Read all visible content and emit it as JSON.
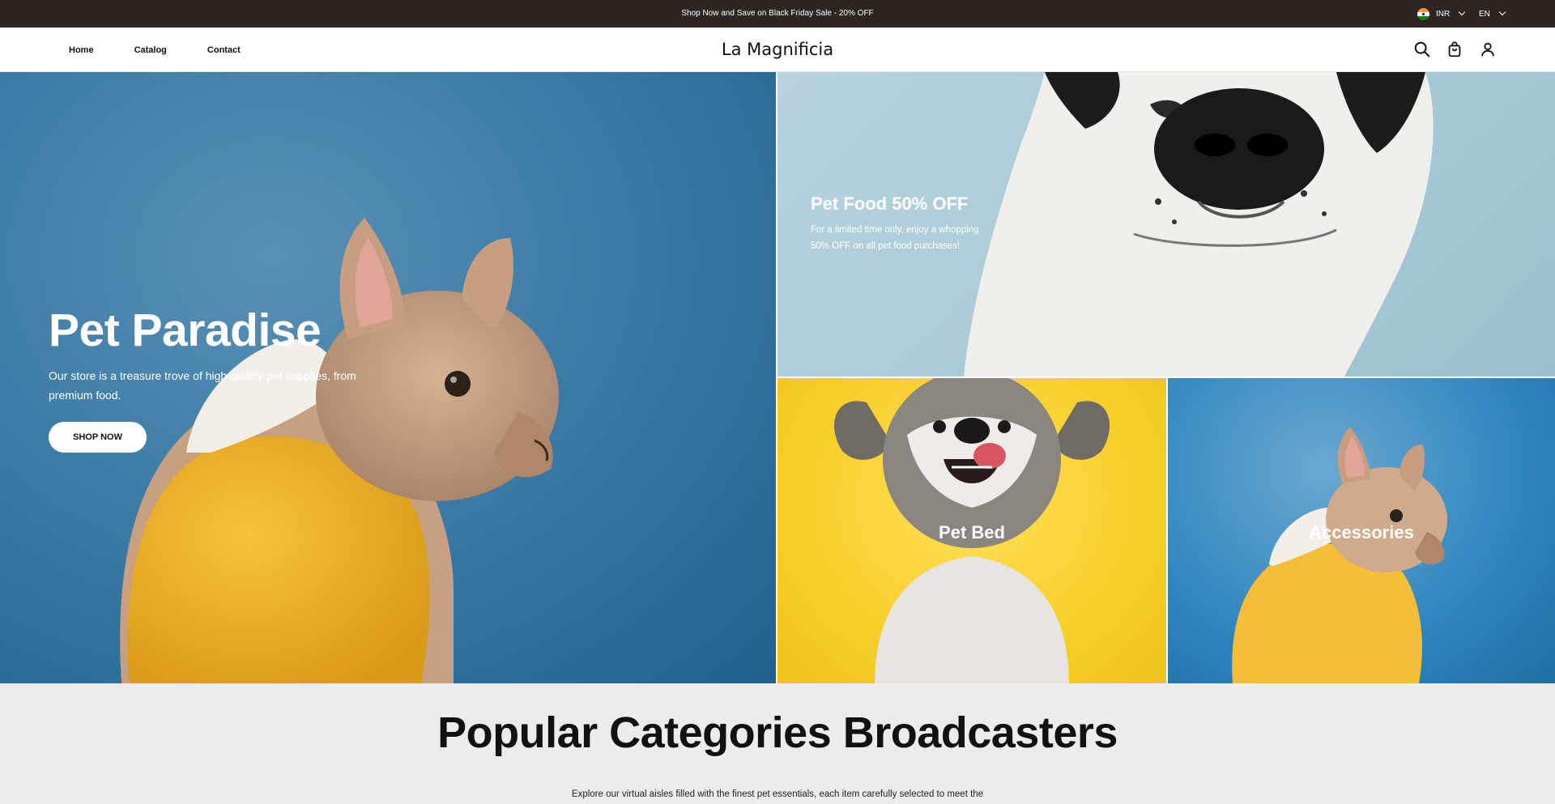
{
  "announcement": {
    "text": "Shop Now and Save on Black Friday Sale - 20% OFF",
    "currency": "INR",
    "language": "EN"
  },
  "header": {
    "nav": [
      "Home",
      "Catalog",
      "Contact"
    ],
    "logo": "La Magnificia",
    "icons": [
      "search-icon",
      "bag-icon",
      "account-icon"
    ]
  },
  "hero": {
    "main": {
      "title": "Pet Paradise",
      "text": "Our store is a treasure trove of high-quality pet supplies, from premium food.",
      "button": "SHOP NOW"
    },
    "food": {
      "title": "Pet Food 50% OFF",
      "text": "For a limited time only, enjoy a whopping 50% OFF on all pet food purchases!"
    },
    "bed": {
      "label": "Pet Bed"
    },
    "accessories": {
      "label": "Accessories"
    }
  },
  "section": {
    "title": "Popular Categories Broadcasters",
    "text": "Explore our virtual aisles filled with the finest pet essentials, each item carefully selected to meet the"
  },
  "colors": {
    "announcement_bg": "#2d2620",
    "hero_blue": "#3f7ea8",
    "food_bg": "#a6c9d6",
    "bed_bg": "#f7cf2a",
    "section_bg": "#ececec"
  }
}
